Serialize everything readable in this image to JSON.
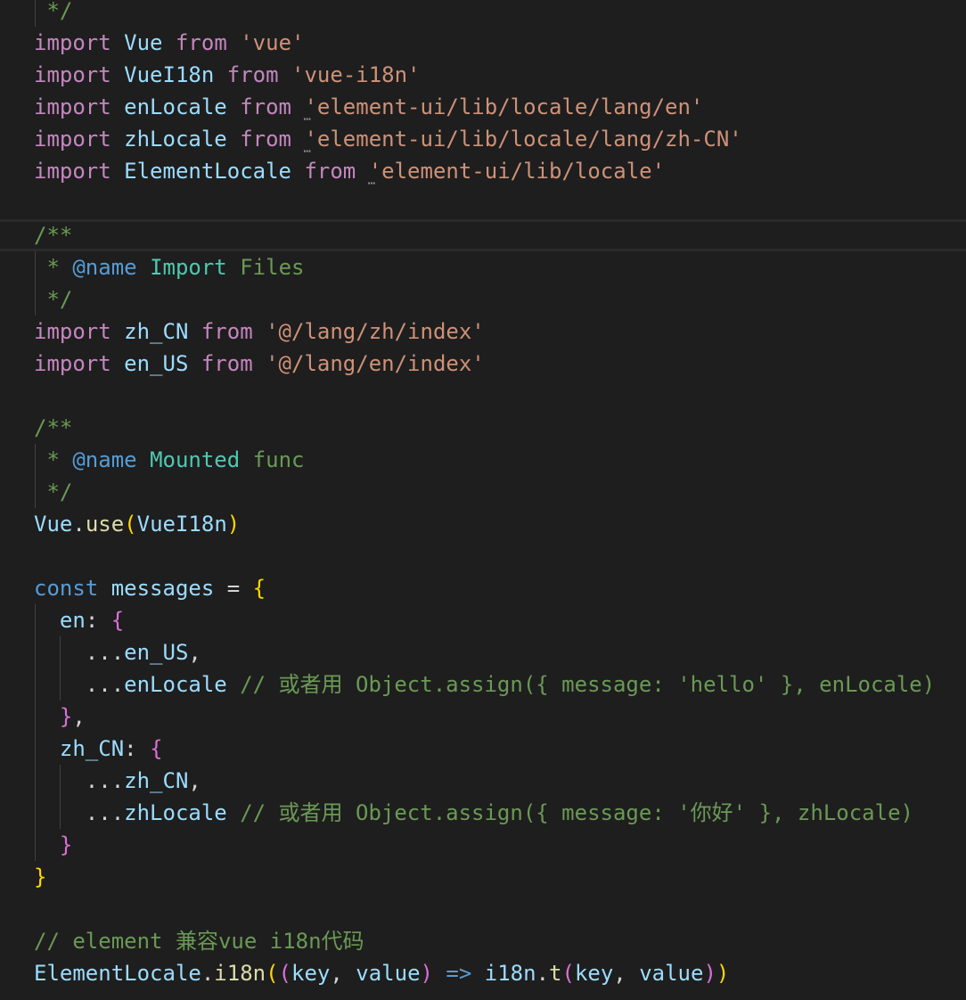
{
  "editor": {
    "code_lines": [
      {
        "tokens": [
          {
            "t": " */",
            "c": "cm"
          }
        ]
      },
      {
        "tokens": [
          {
            "t": "import",
            "c": "kw"
          },
          {
            "t": " ",
            "c": "pl"
          },
          {
            "t": "Vue",
            "c": "id"
          },
          {
            "t": " ",
            "c": "pl"
          },
          {
            "t": "from",
            "c": "kw"
          },
          {
            "t": " ",
            "c": "pl"
          },
          {
            "t": "'vue'",
            "c": "st"
          }
        ]
      },
      {
        "tokens": [
          {
            "t": "import",
            "c": "kw"
          },
          {
            "t": " ",
            "c": "pl"
          },
          {
            "t": "VueI18n",
            "c": "id"
          },
          {
            "t": " ",
            "c": "pl"
          },
          {
            "t": "from",
            "c": "kw"
          },
          {
            "t": " ",
            "c": "pl"
          },
          {
            "t": "'vue-i18n'",
            "c": "st"
          }
        ]
      },
      {
        "tokens": [
          {
            "t": "import",
            "c": "kw"
          },
          {
            "t": " ",
            "c": "pl"
          },
          {
            "t": "enLocale",
            "c": "id"
          },
          {
            "t": " ",
            "c": "pl"
          },
          {
            "t": "from",
            "c": "kw"
          },
          {
            "t": " ",
            "c": "pl"
          },
          {
            "t": "'element-ui/lib/locale/lang/en'",
            "c": "st"
          }
        ],
        "dots": true
      },
      {
        "tokens": [
          {
            "t": "import",
            "c": "kw"
          },
          {
            "t": " ",
            "c": "pl"
          },
          {
            "t": "zhLocale",
            "c": "id"
          },
          {
            "t": " ",
            "c": "pl"
          },
          {
            "t": "from",
            "c": "kw"
          },
          {
            "t": " ",
            "c": "pl"
          },
          {
            "t": "'element-ui/lib/locale/lang/zh-CN'",
            "c": "st"
          }
        ],
        "dots": true
      },
      {
        "tokens": [
          {
            "t": "import",
            "c": "kw"
          },
          {
            "t": " ",
            "c": "pl"
          },
          {
            "t": "ElementLocale",
            "c": "id"
          },
          {
            "t": " ",
            "c": "pl"
          },
          {
            "t": "from",
            "c": "kw"
          },
          {
            "t": " ",
            "c": "pl"
          },
          {
            "t": "'element-ui/lib/locale'",
            "c": "st"
          }
        ],
        "dots": true
      },
      {
        "tokens": []
      },
      {
        "tokens": [
          {
            "t": "/**",
            "c": "cm"
          }
        ],
        "current": true
      },
      {
        "tokens": [
          {
            "t": " * ",
            "c": "cm"
          },
          {
            "t": "@name",
            "c": "ctag"
          },
          {
            "t": " ",
            "c": "cm"
          },
          {
            "t": "Import",
            "c": "ty"
          },
          {
            "t": " Files",
            "c": "cm"
          }
        ]
      },
      {
        "tokens": [
          {
            "t": " */",
            "c": "cm"
          }
        ]
      },
      {
        "tokens": [
          {
            "t": "import",
            "c": "kw"
          },
          {
            "t": " ",
            "c": "pl"
          },
          {
            "t": "zh_CN",
            "c": "id"
          },
          {
            "t": " ",
            "c": "pl"
          },
          {
            "t": "from",
            "c": "kw"
          },
          {
            "t": " ",
            "c": "pl"
          },
          {
            "t": "'@/lang/zh/index'",
            "c": "st"
          }
        ]
      },
      {
        "tokens": [
          {
            "t": "import",
            "c": "kw"
          },
          {
            "t": " ",
            "c": "pl"
          },
          {
            "t": "en_US",
            "c": "id"
          },
          {
            "t": " ",
            "c": "pl"
          },
          {
            "t": "from",
            "c": "kw"
          },
          {
            "t": " ",
            "c": "pl"
          },
          {
            "t": "'@/lang/en/index'",
            "c": "st"
          }
        ]
      },
      {
        "tokens": []
      },
      {
        "tokens": [
          {
            "t": "/**",
            "c": "cm"
          }
        ]
      },
      {
        "tokens": [
          {
            "t": " * ",
            "c": "cm"
          },
          {
            "t": "@name",
            "c": "ctag"
          },
          {
            "t": " ",
            "c": "cm"
          },
          {
            "t": "Mounted",
            "c": "ty"
          },
          {
            "t": " func",
            "c": "cm"
          }
        ]
      },
      {
        "tokens": [
          {
            "t": " */",
            "c": "cm"
          }
        ]
      },
      {
        "tokens": [
          {
            "t": "Vue",
            "c": "id"
          },
          {
            "t": ".",
            "c": "pl"
          },
          {
            "t": "use",
            "c": "fn"
          },
          {
            "t": "(",
            "c": "b1"
          },
          {
            "t": "VueI18n",
            "c": "id"
          },
          {
            "t": ")",
            "c": "b1"
          }
        ]
      },
      {
        "tokens": []
      },
      {
        "tokens": [
          {
            "t": "const",
            "c": "blue"
          },
          {
            "t": " ",
            "c": "pl"
          },
          {
            "t": "messages",
            "c": "id"
          },
          {
            "t": " = ",
            "c": "pl"
          },
          {
            "t": "{",
            "c": "b1"
          }
        ]
      },
      {
        "tokens": [
          {
            "t": "  ",
            "c": "pl"
          },
          {
            "t": "en",
            "c": "id"
          },
          {
            "t": ": ",
            "c": "pl"
          },
          {
            "t": "{",
            "c": "b2"
          }
        ]
      },
      {
        "tokens": [
          {
            "t": "    ...",
            "c": "pl"
          },
          {
            "t": "en_US",
            "c": "id"
          },
          {
            "t": ",",
            "c": "pl"
          }
        ]
      },
      {
        "tokens": [
          {
            "t": "    ...",
            "c": "pl"
          },
          {
            "t": "enLocale",
            "c": "id"
          },
          {
            "t": " // 或者用 Object.assign({ message: 'hello' }, enLocale)",
            "c": "cm"
          }
        ]
      },
      {
        "tokens": [
          {
            "t": "  ",
            "c": "pl"
          },
          {
            "t": "}",
            "c": "b2"
          },
          {
            "t": ",",
            "c": "pl"
          }
        ]
      },
      {
        "tokens": [
          {
            "t": "  ",
            "c": "pl"
          },
          {
            "t": "zh_CN",
            "c": "id"
          },
          {
            "t": ": ",
            "c": "pl"
          },
          {
            "t": "{",
            "c": "b2"
          }
        ]
      },
      {
        "tokens": [
          {
            "t": "    ...",
            "c": "pl"
          },
          {
            "t": "zh_CN",
            "c": "id"
          },
          {
            "t": ",",
            "c": "pl"
          }
        ]
      },
      {
        "tokens": [
          {
            "t": "    ...",
            "c": "pl"
          },
          {
            "t": "zhLocale",
            "c": "id"
          },
          {
            "t": " // 或者用 Object.assign({ message: '你好' }, zhLocale)",
            "c": "cm"
          }
        ]
      },
      {
        "tokens": [
          {
            "t": "  ",
            "c": "pl"
          },
          {
            "t": "}",
            "c": "b2"
          }
        ]
      },
      {
        "tokens": [
          {
            "t": "}",
            "c": "b1"
          }
        ]
      },
      {
        "tokens": []
      },
      {
        "tokens": [
          {
            "t": "// element 兼容vue i18n代码",
            "c": "cm"
          }
        ]
      },
      {
        "tokens": [
          {
            "t": "ElementLocale",
            "c": "id"
          },
          {
            "t": ".",
            "c": "pl"
          },
          {
            "t": "i18n",
            "c": "fn"
          },
          {
            "t": "(",
            "c": "b1"
          },
          {
            "t": "(",
            "c": "b2"
          },
          {
            "t": "key",
            "c": "id"
          },
          {
            "t": ", ",
            "c": "pl"
          },
          {
            "t": "value",
            "c": "id"
          },
          {
            "t": ")",
            "c": "b2"
          },
          {
            "t": " ",
            "c": "pl"
          },
          {
            "t": "=>",
            "c": "blue"
          },
          {
            "t": " ",
            "c": "pl"
          },
          {
            "t": "i18n",
            "c": "id"
          },
          {
            "t": ".",
            "c": "pl"
          },
          {
            "t": "t",
            "c": "fn"
          },
          {
            "t": "(",
            "c": "b2"
          },
          {
            "t": "key",
            "c": "id"
          },
          {
            "t": ", ",
            "c": "pl"
          },
          {
            "t": "value",
            "c": "id"
          },
          {
            "t": ")",
            "c": "b2"
          },
          {
            "t": ")",
            "c": "b1"
          }
        ]
      }
    ],
    "dots_glyph": "⋯",
    "colors": {
      "background": "#1e1e1e",
      "keyword": "#c586c0",
      "string": "#ce9178",
      "variable": "#9cdcfe",
      "type": "#4ec9b0",
      "function": "#dcdcaa",
      "comment": "#6a9955",
      "storage": "#569cd6",
      "bracket_level1": "#ffd700",
      "bracket_level2": "#da70d6"
    }
  }
}
